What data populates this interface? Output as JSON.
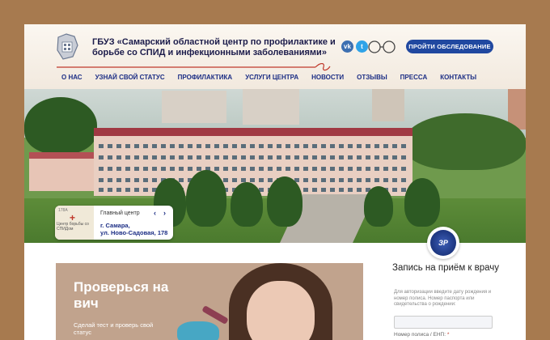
{
  "header": {
    "org_title": "ГБУЗ «Самарский областной центр по профилактике и борьбе со СПИД и инфекционными заболеваниями»",
    "exam_button": "ПРОЙТИ ОБСЛЕДОВАНИЕ",
    "social": {
      "vk": "vk",
      "twitter": "t"
    }
  },
  "nav": {
    "items": [
      "О НАС",
      "УЗНАЙ СВОЙ СТАТУС",
      "ПРОФИЛАКТИКА",
      "УСЛУГИ ЦЕНТРА",
      "НОВОСТИ",
      "ОТЗЫВЫ",
      "ПРЕССА",
      "КОНТАКТЫ"
    ]
  },
  "map_card": {
    "heading": "Главный центр",
    "address_line1": "г. Самара,",
    "address_line2": "ул. Ново-Садовая, 178",
    "thumb_street": "178А",
    "thumb_label": "Центр борьбы со СПИДом"
  },
  "badge": {
    "text": "ЗР"
  },
  "promo": {
    "title": "Проверься на вич",
    "subtitle": "Сделай тест и проверь свой статус"
  },
  "appointment": {
    "title": "Запись на приём к врачу",
    "description": "Для авторизации введите дату рождения и номер полиса. Номер паспорта или свидетельства о рождении:",
    "field_label": "Номер полиса / ЕНП:",
    "required_mark": "*"
  },
  "colors": {
    "accent_blue": "#1c2e85",
    "button_blue": "#2048a0",
    "roof_red": "#a03943",
    "promo_bg": "#c1a38d",
    "frame_brown": "#a77a4f"
  },
  "icons": [
    "logo-icon",
    "vk-icon",
    "twitter-icon",
    "accessibility-glasses-icon",
    "map-pin-icon",
    "chevron-left-icon",
    "chevron-right-icon"
  ]
}
